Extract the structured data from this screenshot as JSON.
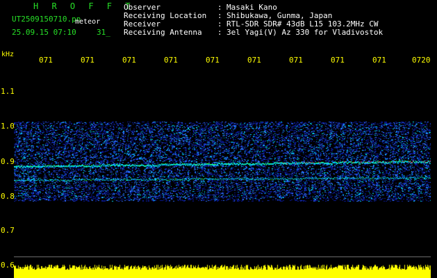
{
  "header": {
    "title": "H R O F F T",
    "filename": "UT2509150710.pn",
    "file_sub": "meteor",
    "datetime": "25.09.15 07:10",
    "number": "31_",
    "rows": [
      {
        "label": "Observer",
        "value": "Masaki Kano"
      },
      {
        "label": "Receiving Location",
        "value": "Shibukawa, Gunma, Japan"
      },
      {
        "label": "Receiver",
        "value": "RTL-SDR SDR# 43dB L15 103.2MHz CW"
      },
      {
        "label": "Receiving Antenna",
        "value": "3el Yagi(V) Az 330 for Vladivostok"
      }
    ],
    "separator": ":"
  },
  "axis": {
    "unit": "kHz",
    "time_labels": [
      "071",
      "071",
      "071",
      "071",
      "071",
      "071",
      "071",
      "071",
      "071",
      "0720"
    ],
    "y_ticks": [
      "1.1",
      "1.0",
      "0.9",
      "0.8",
      "0.7",
      "0.6"
    ]
  },
  "colors": {
    "label_green": "#27e027",
    "text_white": "#ffffff",
    "time_yellow": "#ffff00",
    "noise_dark_blue": "#0a1a9a",
    "noise_blue": "#2f6bff",
    "noise_cyan": "#00e0ff",
    "signal_green": "#30ff30",
    "signal_red": "#ff2020",
    "level_yellow": "#ffff00"
  }
}
